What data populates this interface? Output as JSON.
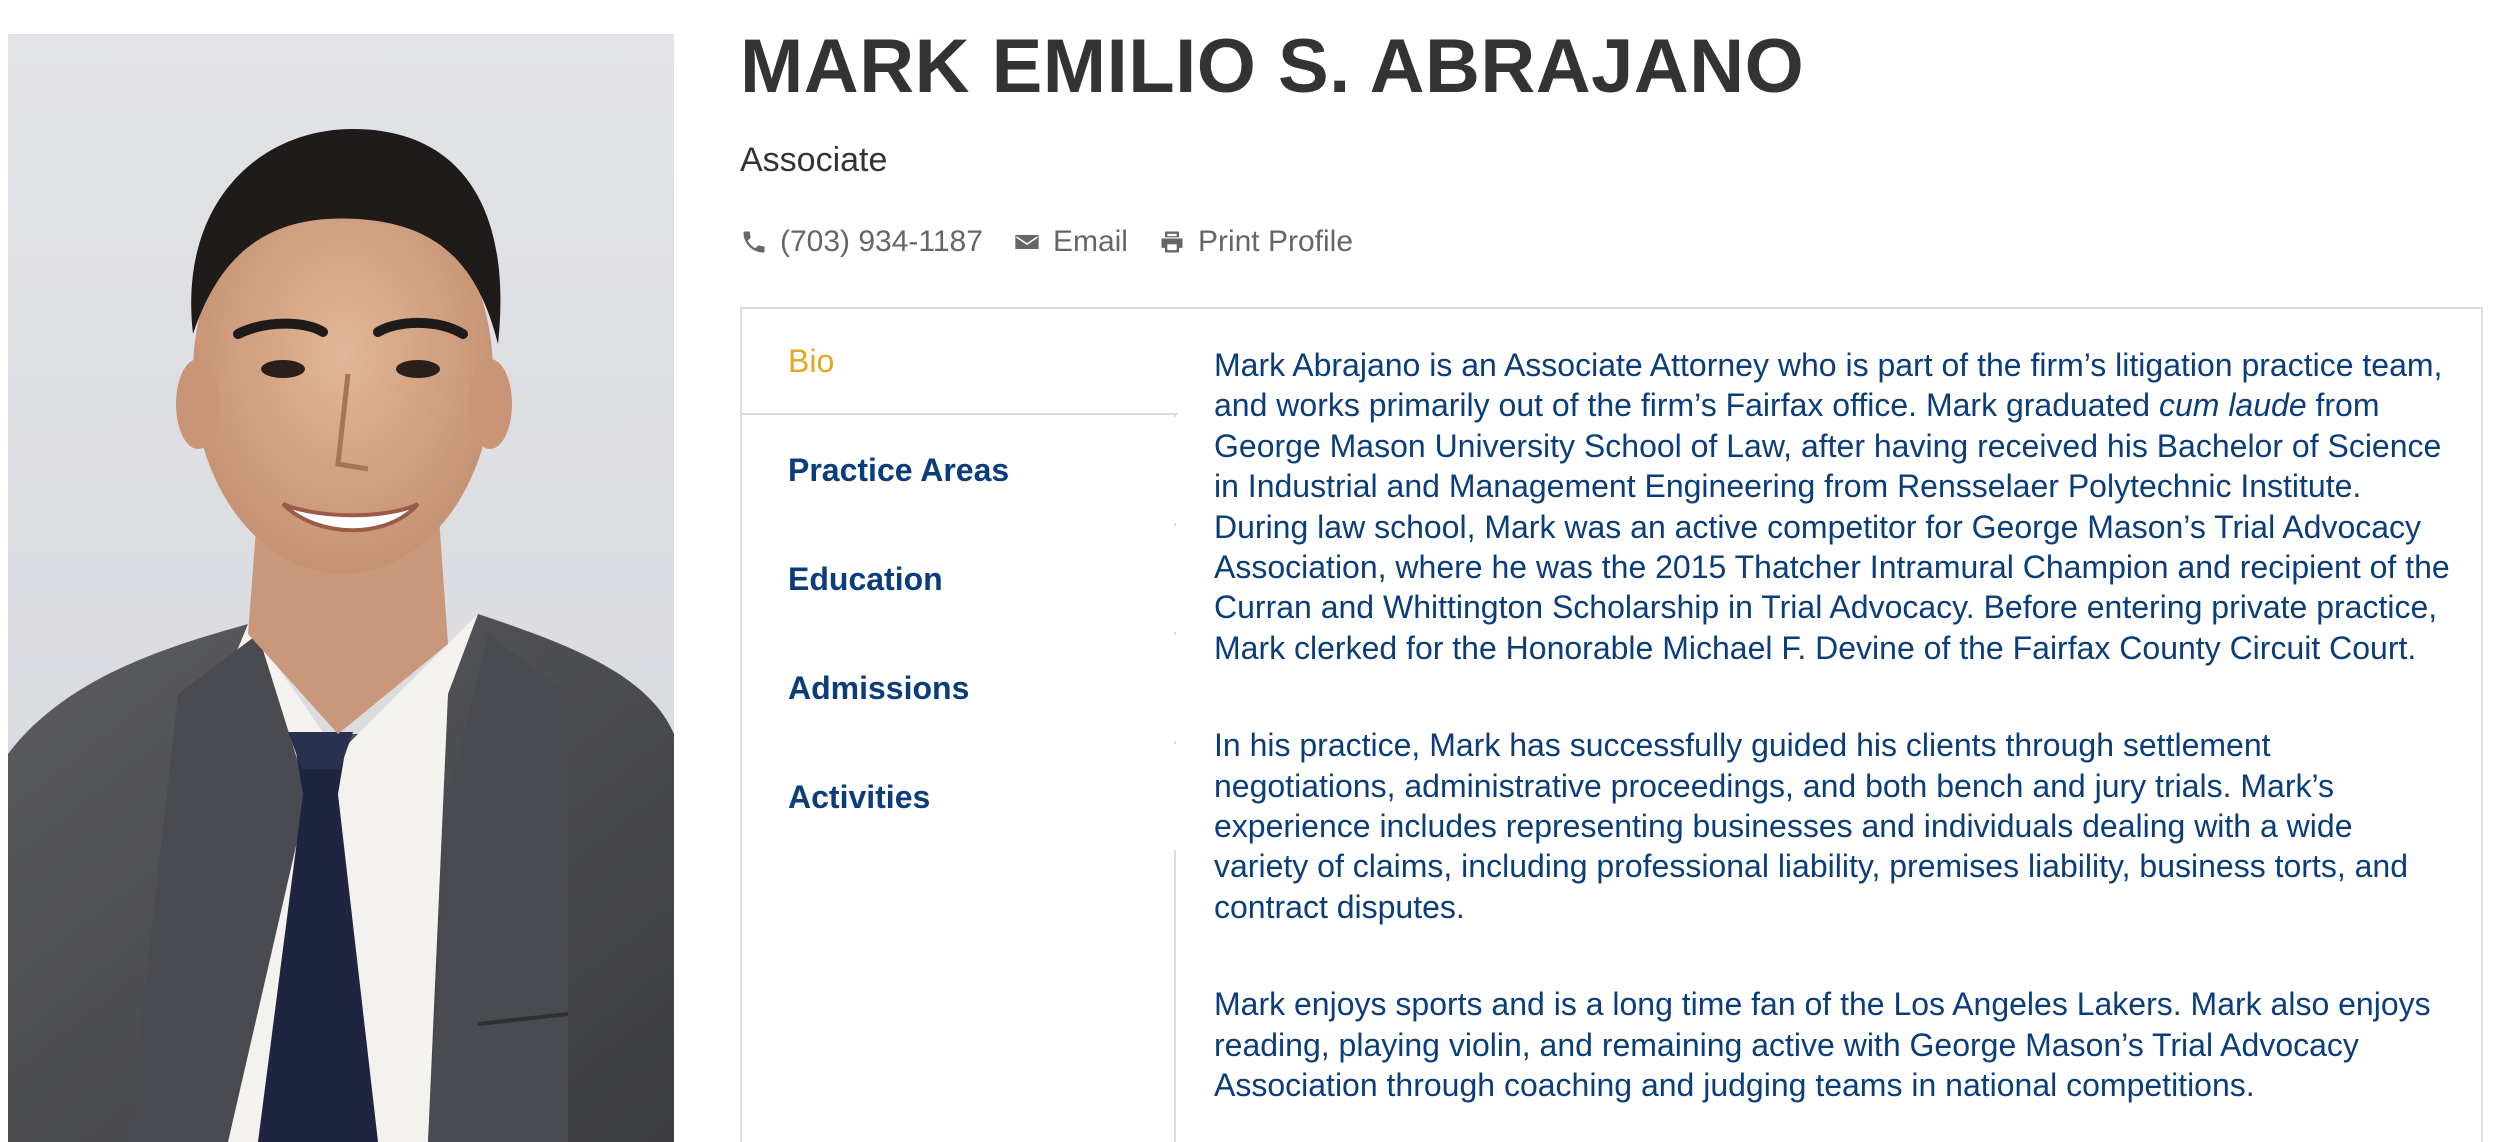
{
  "profile": {
    "name": "MARK EMILIO S. ABRAJANO",
    "title": "Associate",
    "portrait_icon": "attorney-portrait-photo"
  },
  "contacts": {
    "phone": "(703) 934-1187",
    "email_label": "Email",
    "print_label": "Print Profile"
  },
  "tabs": [
    {
      "label": "Bio",
      "active": true
    },
    {
      "label": "Practice Areas",
      "active": false
    },
    {
      "label": "Education",
      "active": false
    },
    {
      "label": "Admissions",
      "active": false
    },
    {
      "label": "Activities",
      "active": false
    }
  ],
  "bio": {
    "p1_a": "Mark Abrajano is an Associate Attorney who is part of the firm’s litigation practice team, and works primarily out of the firm’s Fairfax office. Mark graduated ",
    "p1_em": "cum laude",
    "p1_b": " from George Mason University School of Law, after having received his Bachelor of Science in Industrial and Management Engineering from Rensselaer Polytechnic Institute. During law school, Mark was an active competitor for George Mason’s Trial Advocacy Association, where he was the 2015 Thatcher Intramural Champion and recipient of the Curran and Whittington Scholarship in Trial Advocacy. Before entering private practice, Mark clerked for the Honorable Michael F. Devine of the Fairfax County Circuit Court.",
    "p2": "In his practice, Mark has successfully guided his clients through settlement negotiations, administrative proceedings, and both bench and jury trials. Mark’s experience includes representing businesses and individuals dealing with a wide variety of claims, including professional liability, premises liability, business torts, and contract disputes.",
    "p3": "Mark enjoys sports and is a long time fan of the Los Angeles Lakers. Mark also enjoys reading, playing violin, and remaining active with George Mason’s Trial Advocacy Association through coaching and judging teams in national competitions."
  },
  "colors": {
    "heading": "#333333",
    "link_blue": "#0a3d7a",
    "active_tab": "#e6a61e",
    "border": "#dcdcdc",
    "muted": "#666666"
  }
}
